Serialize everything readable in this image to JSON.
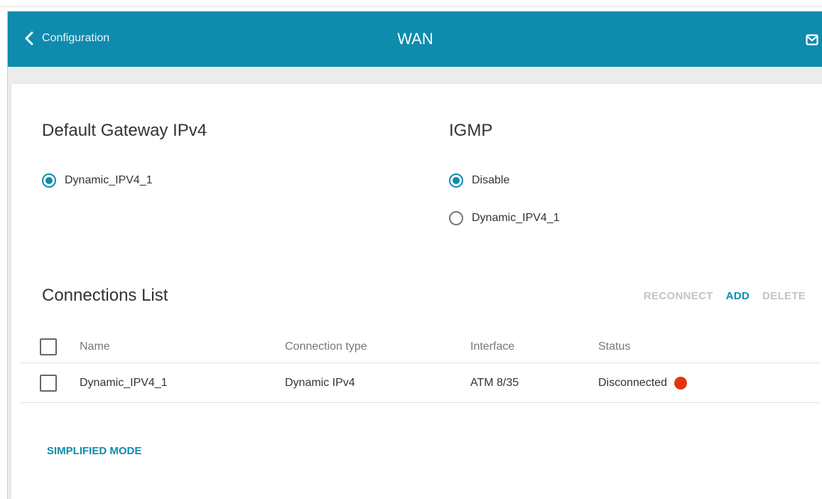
{
  "header": {
    "back_label": "Configuration",
    "title": "WAN",
    "mail_icon": "mail-icon"
  },
  "gateway": {
    "title": "Default Gateway IPv4",
    "options": [
      {
        "label": "Dynamic_IPV4_1",
        "selected": true
      }
    ]
  },
  "igmp": {
    "title": "IGMP",
    "options": [
      {
        "label": "Disable",
        "selected": true
      },
      {
        "label": "Dynamic_IPV4_1",
        "selected": false
      }
    ]
  },
  "connections": {
    "title": "Connections List",
    "actions": {
      "reconnect": "RECONNECT",
      "add": "ADD",
      "delete": "DELETE"
    },
    "columns": [
      "Name",
      "Connection type",
      "Interface",
      "Status"
    ],
    "rows": [
      {
        "name": "Dynamic_IPV4_1",
        "type": "Dynamic IPv4",
        "interface": "ATM 8/35",
        "status": "Disconnected",
        "status_color": "#e1360d"
      }
    ]
  },
  "footer": {
    "simplified_mode": "SIMPLIFIED MODE"
  },
  "colors": {
    "accent": "#0e8bad",
    "disabled": "#c4c4c4",
    "status_disconnected": "#e1360d"
  }
}
